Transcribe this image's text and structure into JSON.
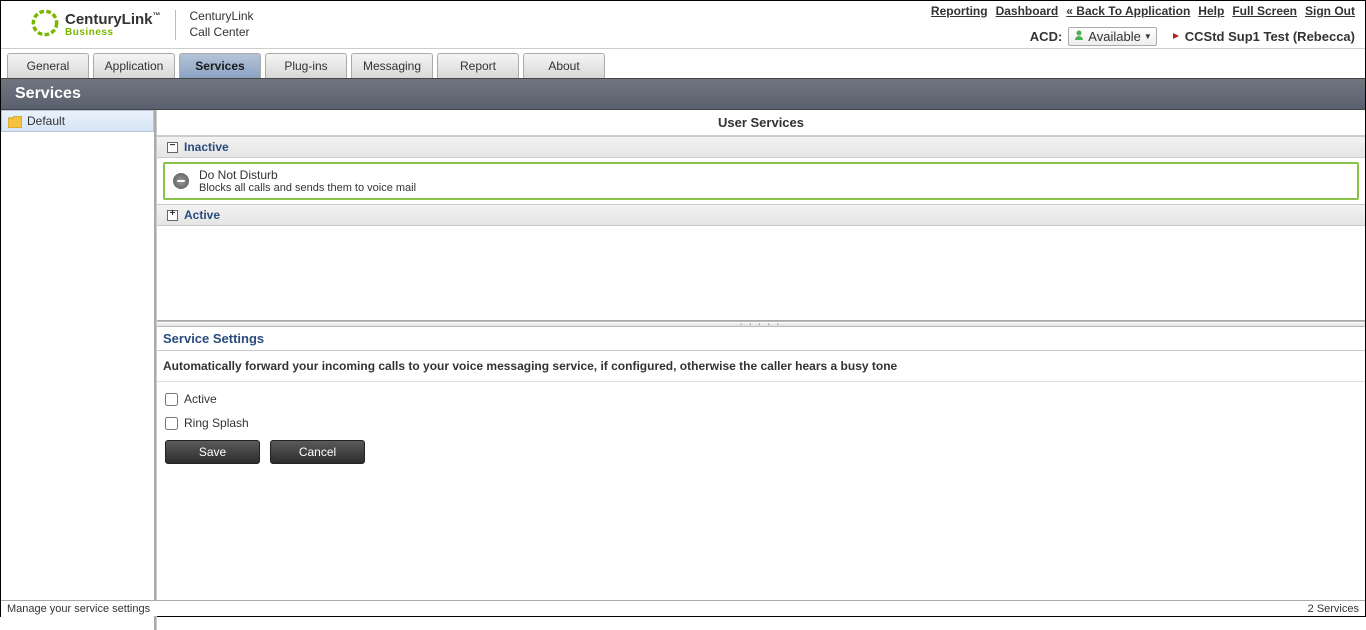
{
  "header": {
    "brand_main": "CenturyLink",
    "brand_tm": "™",
    "brand_sub": "Business",
    "app_line1": "CenturyLink",
    "app_line2": "Call Center",
    "top_links": [
      "Reporting",
      "Dashboard",
      "« Back To Application",
      "Help",
      "Full Screen",
      "Sign Out"
    ],
    "acd_label": "ACD:",
    "acd_status": "Available",
    "user_name": "CCStd Sup1 Test (Rebecca)"
  },
  "tabs": [
    "General",
    "Application",
    "Services",
    "Plug-ins",
    "Messaging",
    "Report",
    "About"
  ],
  "active_tab_index": 2,
  "section_title": "Services",
  "sidebar": {
    "items": [
      {
        "label": "Default"
      }
    ]
  },
  "services_panel": {
    "title": "User Services",
    "groups": {
      "inactive": {
        "label": "Inactive",
        "expanded": true,
        "items": [
          {
            "name": "Do Not Disturb",
            "desc": "Blocks all calls and sends them to voice mail"
          }
        ]
      },
      "active": {
        "label": "Active",
        "expanded": false
      }
    }
  },
  "settings": {
    "title": "Service Settings",
    "description": "Automatically forward your incoming calls to your voice messaging service, if configured, otherwise the caller hears a busy tone",
    "checkboxes": {
      "active": "Active",
      "ring_splash": "Ring Splash"
    },
    "buttons": {
      "save": "Save",
      "cancel": "Cancel"
    }
  },
  "status": {
    "left": "Manage your service settings",
    "right": "2 Services"
  }
}
